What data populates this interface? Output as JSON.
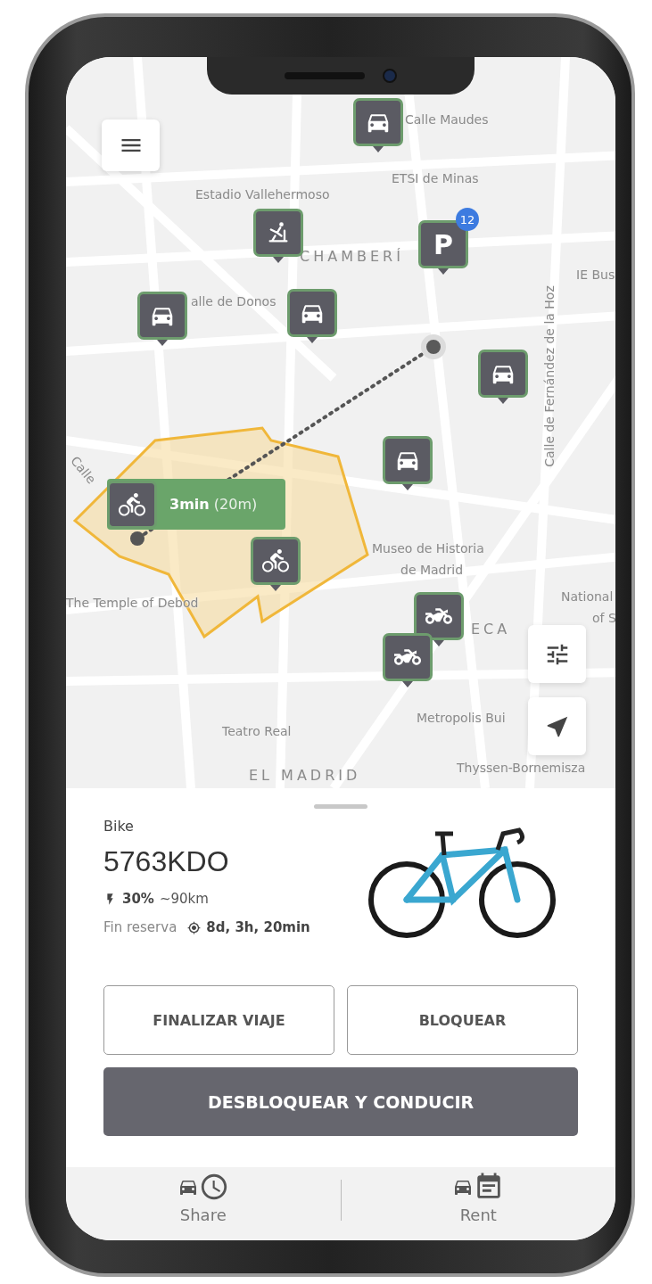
{
  "map": {
    "labels": [
      {
        "text": "Calle Maudes",
        "kind": "street"
      },
      {
        "text": "ETSI de Minas",
        "kind": "street"
      },
      {
        "text": "Estadio Vallehermoso",
        "kind": "street"
      },
      {
        "text": "CHAMBERÍ",
        "kind": "district"
      },
      {
        "text": "IE Bus",
        "kind": "street"
      },
      {
        "text": "alle de Donos",
        "kind": "street"
      },
      {
        "text": "Calle de Fernández de la Hoz",
        "kind": "vertical"
      },
      {
        "text": "Calle",
        "kind": "slanted"
      },
      {
        "text": "Museo de Historia",
        "kind": "street"
      },
      {
        "text": "de Madrid",
        "kind": "street"
      },
      {
        "text": "The Temple of Debod",
        "kind": "street"
      },
      {
        "text": "National",
        "kind": "street"
      },
      {
        "text": "of S",
        "kind": "street"
      },
      {
        "text": "ECA",
        "kind": "district"
      },
      {
        "text": "Metropolis Bui",
        "kind": "street"
      },
      {
        "text": "Teatro Real",
        "kind": "street"
      },
      {
        "text": "EL MADRID",
        "kind": "district"
      },
      {
        "text": "Thyssen-Bornemisza",
        "kind": "street"
      }
    ],
    "markers": [
      {
        "kind": "car"
      },
      {
        "kind": "elliptical"
      },
      {
        "kind": "parking",
        "label": "P",
        "badge": "12"
      },
      {
        "kind": "car"
      },
      {
        "kind": "car"
      },
      {
        "kind": "car"
      },
      {
        "kind": "car"
      },
      {
        "kind": "bike"
      },
      {
        "kind": "scooter"
      },
      {
        "kind": "scooter"
      }
    ],
    "callout": {
      "duration": "3min",
      "distance": "(20m)"
    }
  },
  "sheet": {
    "type": "Bike",
    "plate": "5763KDO",
    "battery": "30%",
    "range": "~90km",
    "reservation_label": "Fin reserva",
    "reservation_time": "8d, 3h, 20min"
  },
  "buttons": [
    {
      "label": "FINALIZAR VIAJE",
      "kind": "outline"
    },
    {
      "label": "BLOQUEAR",
      "kind": "outline"
    },
    {
      "label": "DESBLOQUEAR Y CONDUCIR",
      "kind": "primary"
    }
  ],
  "tabs": [
    {
      "label": "Share",
      "kind": "share"
    },
    {
      "label": "Rent",
      "kind": "rent"
    }
  ]
}
